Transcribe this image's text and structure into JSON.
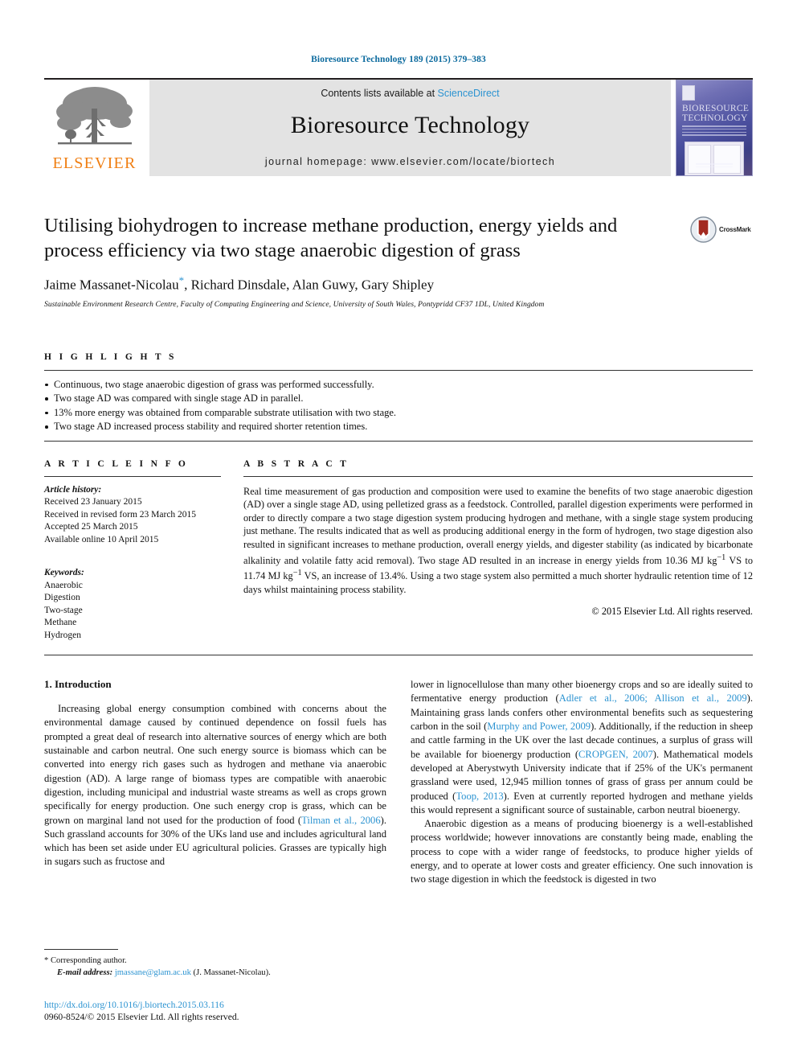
{
  "running_head": "Bioresource Technology 189 (2015) 379–383",
  "masthead": {
    "publisher_name": "ELSEVIER",
    "contents_prefix": "Contents lists available at ",
    "contents_link": "ScienceDirect",
    "journal_name": "Bioresource Technology",
    "homepage": "journal homepage: www.elsevier.com/locate/biortech",
    "cover": {
      "title_line1": "BIORESOURCE",
      "title_line2": "TECHNOLOGY"
    }
  },
  "article": {
    "title": "Utilising biohydrogen to increase methane production, energy yields and process efficiency via two stage anaerobic digestion of grass",
    "authors": "Jaime Massanet-Nicolau",
    "authors_rest": ", Richard Dinsdale, Alan Guwy, Gary Shipley",
    "corresponding_marker": "*",
    "affiliation": "Sustainable Environment Research Centre, Faculty of Computing Engineering and Science, University of South Wales, Pontypridd CF37 1DL, United Kingdom",
    "crossmark_label": "CrossMark"
  },
  "highlights": {
    "heading": "H I G H L I G H T S",
    "items": [
      "Continuous, two stage anaerobic digestion of grass was performed successfully.",
      "Two stage AD was compared with single stage AD in parallel.",
      "13% more energy was obtained from comparable substrate utilisation with two stage.",
      "Two stage AD increased process stability and required shorter retention times."
    ]
  },
  "article_info": {
    "heading": "A R T I C L E   I N F O",
    "history_label": "Article history:",
    "history": [
      "Received 23 January 2015",
      "Received in revised form 23 March 2015",
      "Accepted 25 March 2015",
      "Available online 10 April 2015"
    ],
    "keywords_label": "Keywords:",
    "keywords": [
      "Anaerobic",
      "Digestion",
      "Two-stage",
      "Methane",
      "Hydrogen"
    ]
  },
  "abstract": {
    "heading": "A B S T R A C T",
    "text": "Real time measurement of gas production and composition were used to examine the benefits of two stage anaerobic digestion (AD) over a single stage AD, using pelletized grass as a feedstock. Controlled, parallel digestion experiments were performed in order to directly compare a two stage digestion system producing hydrogen and methane, with a single stage system producing just methane. The results indicated that as well as producing additional energy in the form of hydrogen, two stage digestion also resulted in significant increases to methane production, overall energy yields, and digester stability (as indicated by bicarbonate alkalinity and volatile fatty acid removal). Two stage AD resulted in an increase in energy yields from 10.36 MJ kg",
    "text_sup1": "−1",
    "text_mid": " VS to 11.74 MJ kg",
    "text_sup2": "−1",
    "text_end": " VS, an increase of 13.4%. Using a two stage system also permitted a much shorter hydraulic retention time of 12 days whilst maintaining process stability.",
    "copyright": "© 2015 Elsevier Ltd. All rights reserved."
  },
  "introduction": {
    "heading": "1. Introduction",
    "left_para1_a": "Increasing global energy consumption combined with concerns about the environmental damage caused by continued dependence on fossil fuels has prompted a great deal of research into alternative sources of energy which are both sustainable and carbon neutral. One such energy source is biomass which can be converted into energy rich gases such as hydrogen and methane via anaerobic digestion (AD). A large range of biomass types are compatible with anaerobic digestion, including municipal and industrial waste streams as well as crops grown specifically for energy production. One such energy crop is grass, which can be grown on marginal land not used for the production of food (",
    "left_cite1": "Tilman et al., 2006",
    "left_para1_b": "). Such grassland accounts for 30% of the UKs land use and includes agricultural land which has been set aside under EU agricultural policies. Grasses are typically high in sugars such as fructose and",
    "right_para1_a": "lower in lignocellulose than many other bioenergy crops and so are ideally suited to fermentative energy production (",
    "right_cite1": "Adler et al., 2006; Allison et al., 2009",
    "right_para1_b": "). Maintaining grass lands confers other environmental benefits such as sequestering carbon in the soil (",
    "right_cite2": "Murphy and Power, 2009",
    "right_para1_c": "). Additionally, if the reduction in sheep and cattle farming in the UK over the last decade continues, a surplus of grass will be available for bioenergy production (",
    "right_cite3": "CROPGEN, 2007",
    "right_para1_d": "). Mathematical models developed at Aberystwyth University indicate that if 25% of the UK's permanent grassland were used, 12,945 million tonnes of grass of grass per annum could be produced (",
    "right_cite4": "Toop, 2013",
    "right_para1_e": "). Even at currently reported hydrogen and methane yields this would represent a significant source of sustainable, carbon neutral bioenergy.",
    "right_para2": "Anaerobic digestion as a means of producing bioenergy is a well-established process worldwide; however innovations are constantly being made, enabling the process to cope with a wider range of feedstocks, to produce higher yields of energy, and to operate at lower costs and greater efficiency. One such innovation is two stage digestion in which the feedstock is digested in two"
  },
  "footer": {
    "corresponding_marker": "*",
    "corresponding_label": "Corresponding author.",
    "email_label": "E-mail address:",
    "email": "jmassane@glam.ac.uk",
    "email_owner": "(J. Massanet-Nicolau).",
    "doi": "http://dx.doi.org/10.1016/j.biortech.2015.03.116",
    "issn_copyright": "0960-8524/© 2015 Elsevier Ltd. All rights reserved."
  },
  "colors": {
    "link_blue": "#2b93d1",
    "running_head_blue": "#0b6a9e",
    "elsevier_orange": "#f07f13",
    "band_grey": "#e3e3e3"
  }
}
